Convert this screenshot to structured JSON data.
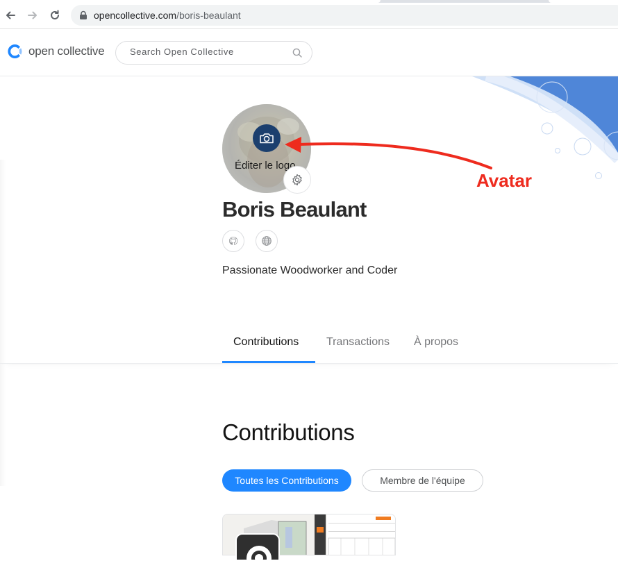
{
  "browser": {
    "url_host": "opencollective.com",
    "url_path": "/boris-beaulant"
  },
  "header": {
    "logo_text": "open collective",
    "search_placeholder": "Search Open Collective"
  },
  "profile": {
    "edit_logo_label": "Éditer le logo",
    "name": "Boris Beaulant",
    "tagline": "Passionate Woodworker and Coder",
    "social_links": [
      "github-icon",
      "globe-icon"
    ]
  },
  "annotation": {
    "label": "Avatar",
    "color": "#ee2b1e"
  },
  "tabs": [
    {
      "label": "Contributions",
      "active": true
    },
    {
      "label": "Transactions",
      "active": false
    },
    {
      "label": "À propos",
      "active": false
    }
  ],
  "contributions": {
    "title": "Contributions",
    "filters": [
      {
        "label": "Toutes les Contributions",
        "selected": true
      },
      {
        "label": "Membre de l'équipe",
        "selected": false
      }
    ]
  },
  "colors": {
    "accent": "#1f87ff",
    "camera_button": "#1b3f6e"
  }
}
